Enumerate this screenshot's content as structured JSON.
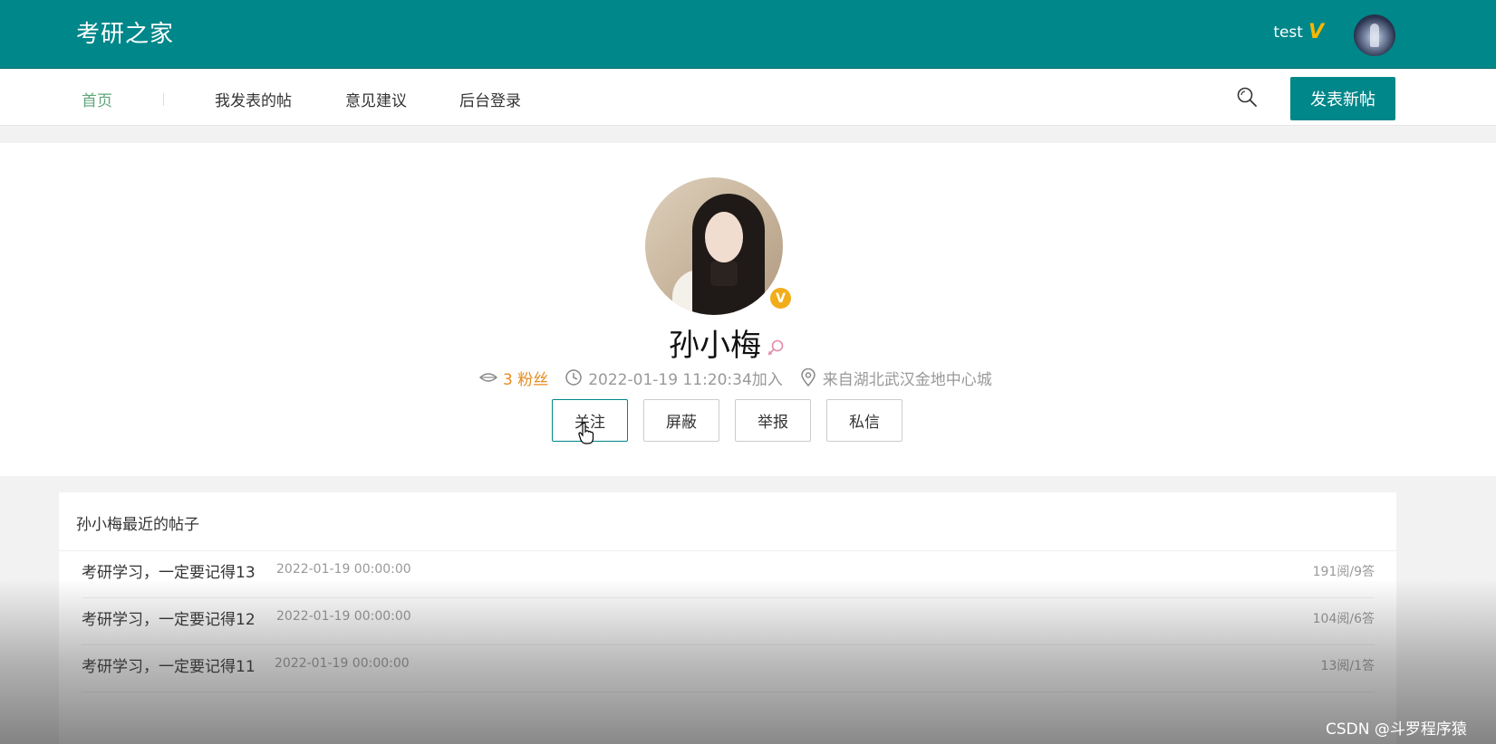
{
  "header": {
    "logo": "考研之家",
    "username": "test",
    "vip_mark": "V"
  },
  "nav": {
    "items": [
      {
        "label": "首页",
        "active": true
      },
      {
        "label": "我发表的帖"
      },
      {
        "label": "意见建议"
      },
      {
        "label": "后台登录"
      }
    ],
    "post_button": "发表新帖"
  },
  "profile": {
    "name": "孙小梅",
    "verified_badge": "V",
    "fans": "3 粉丝",
    "joined": "2022-01-19 11:20:34加入",
    "location": "来自湖北武汉金地中心城",
    "actions": {
      "follow": "关注",
      "block": "屏蔽",
      "report": "举报",
      "message": "私信"
    }
  },
  "posts": {
    "title": "孙小梅最近的帖子",
    "items": [
      {
        "title": "考研学习，一定要记得13",
        "date": "2022-01-19 00:00:00",
        "stats": "191阅/9答"
      },
      {
        "title": "考研学习，一定要记得12",
        "date": "2022-01-19 00:00:00",
        "stats": "104阅/6答"
      },
      {
        "title": "考研学习，一定要记得11",
        "date": "2022-01-19 00:00:00",
        "stats": "13阅/1答"
      }
    ]
  },
  "watermark": "CSDN @斗罗程序猿",
  "colors": {
    "primary": "#00878a",
    "accent_orange": "#e98a1f",
    "nav_active": "#5fa57a",
    "vip_gold": "#f5b800"
  }
}
